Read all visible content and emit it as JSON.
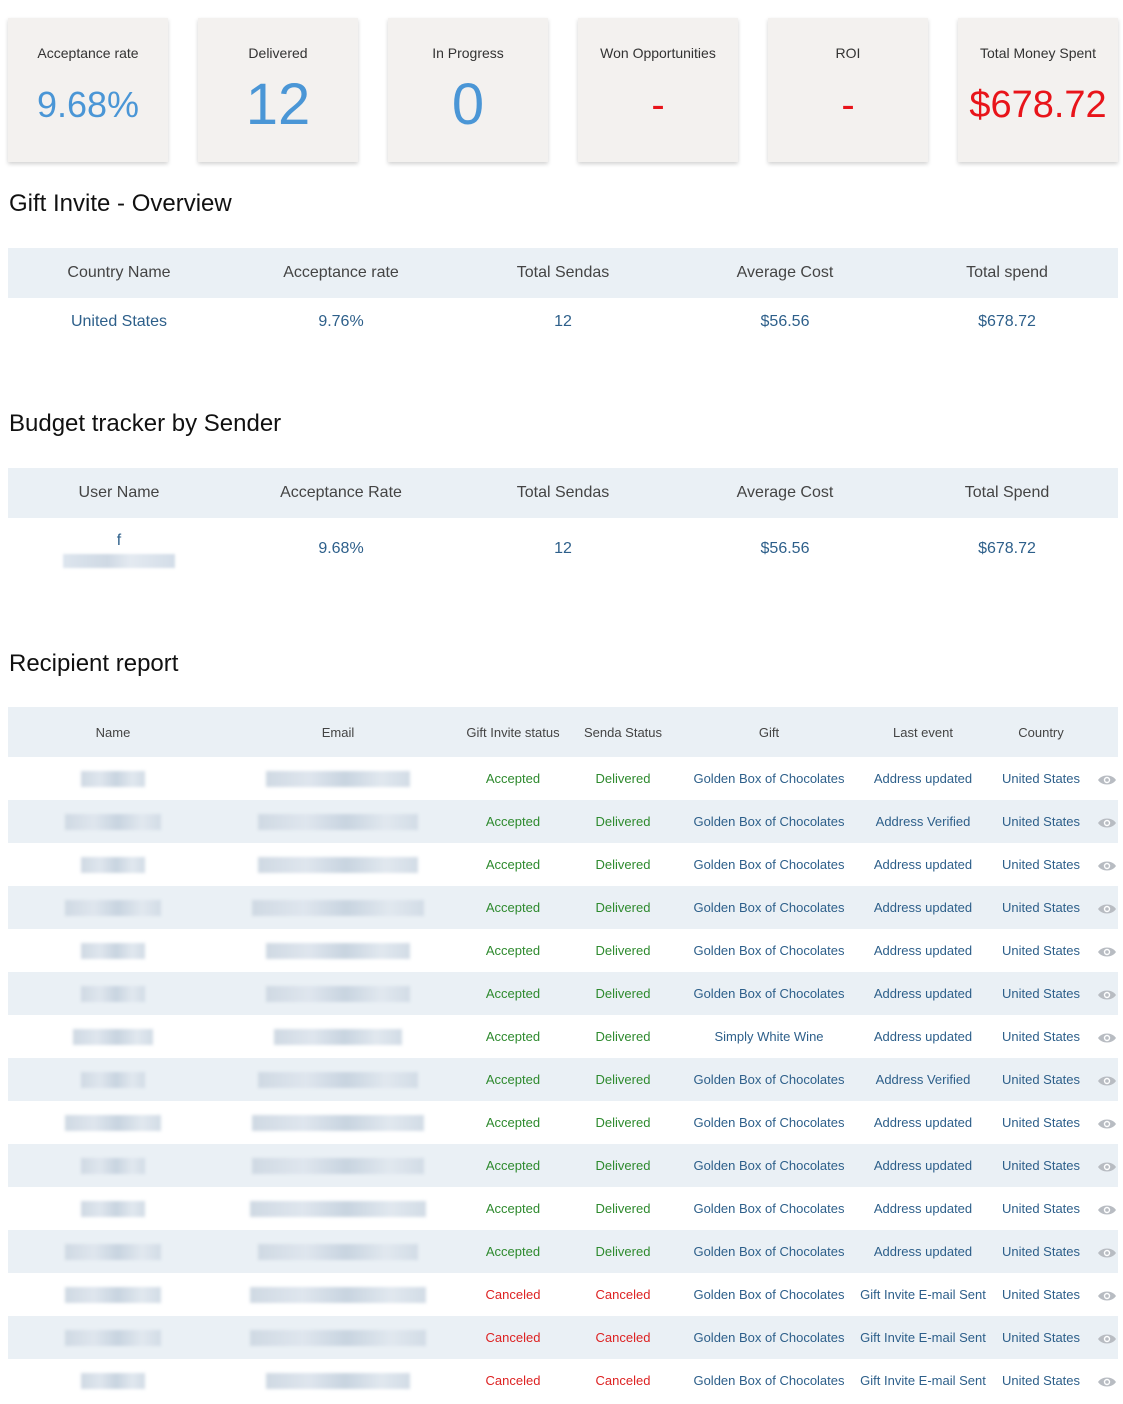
{
  "kpis": [
    {
      "label": "Acceptance rate",
      "value": "9.68%",
      "color": "#4a96d6",
      "size": 36
    },
    {
      "label": "Delivered",
      "value": "12",
      "color": "#4a96d6",
      "size": 58
    },
    {
      "label": "In Progress",
      "value": "0",
      "color": "#4a96d6",
      "size": 58
    },
    {
      "label": "Won Opportunities",
      "value": "-",
      "color": "#e8141a",
      "size": 40
    },
    {
      "label": "ROI",
      "value": "-",
      "color": "#e8141a",
      "size": 40
    },
    {
      "label": "Total Money Spent",
      "value": "$678.72",
      "color": "#e8141a",
      "size": 38
    }
  ],
  "overview": {
    "title": "Gift Invite - Overview",
    "headers": [
      "Country Name",
      "Acceptance rate",
      "Total Sendas",
      "Average Cost",
      "Total spend"
    ],
    "row": [
      "United States",
      "9.76%",
      "12",
      "$56.56",
      "$678.72"
    ]
  },
  "budget": {
    "title": "Budget tracker by Sender",
    "headers": [
      "User Name",
      "Acceptance Rate",
      "Total Sendas",
      "Average Cost",
      "Total Spend"
    ],
    "row": [
      "f",
      "9.68%",
      "12",
      "$56.56",
      "$678.72"
    ]
  },
  "report": {
    "title": "Recipient report",
    "headers": [
      "Name",
      "Email",
      "Gift Invite status",
      "Senda Status",
      "Gift",
      "Last event",
      "Country"
    ],
    "rows": [
      [
        "Accepted",
        "Delivered",
        "Golden Box of Chocolates",
        "Address updated",
        "United States"
      ],
      [
        "Accepted",
        "Delivered",
        "Golden Box of Chocolates",
        "Address Verified",
        "United States"
      ],
      [
        "Accepted",
        "Delivered",
        "Golden Box of Chocolates",
        "Address updated",
        "United States"
      ],
      [
        "Accepted",
        "Delivered",
        "Golden Box of Chocolates",
        "Address updated",
        "United States"
      ],
      [
        "Accepted",
        "Delivered",
        "Golden Box of Chocolates",
        "Address updated",
        "United States"
      ],
      [
        "Accepted",
        "Delivered",
        "Golden Box of Chocolates",
        "Address updated",
        "United States"
      ],
      [
        "Accepted",
        "Delivered",
        "Simply White Wine",
        "Address updated",
        "United States"
      ],
      [
        "Accepted",
        "Delivered",
        "Golden Box of Chocolates",
        "Address Verified",
        "United States"
      ],
      [
        "Accepted",
        "Delivered",
        "Golden Box of Chocolates",
        "Address updated",
        "United States"
      ],
      [
        "Accepted",
        "Delivered",
        "Golden Box of Chocolates",
        "Address updated",
        "United States"
      ],
      [
        "Accepted",
        "Delivered",
        "Golden Box of Chocolates",
        "Address updated",
        "United States"
      ],
      [
        "Accepted",
        "Delivered",
        "Golden Box of Chocolates",
        "Address updated",
        "United States"
      ],
      [
        "Canceled",
        "Canceled",
        "Golden Box of Chocolates",
        "Gift Invite E-mail Sent",
        "United States"
      ],
      [
        "Canceled",
        "Canceled",
        "Golden Box of Chocolates",
        "Gift Invite E-mail Sent",
        "United States"
      ],
      [
        "Canceled",
        "Canceled",
        "Golden Box of Chocolates",
        "Gift Invite E-mail Sent",
        "United States"
      ]
    ]
  },
  "colors": {
    "accepted": "#2e8a2e",
    "canceled": "#dd2222",
    "link": "#2d5f8a",
    "header_bg": "#eaf0f5"
  },
  "icons": {
    "row_action": "eye-icon"
  }
}
